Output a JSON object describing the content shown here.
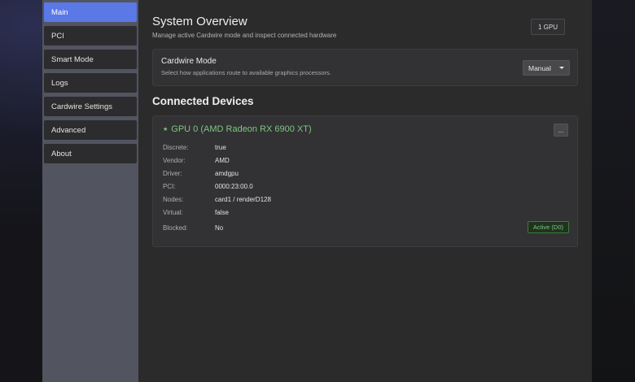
{
  "sidebar": {
    "items": [
      {
        "id": "main",
        "label": "Main",
        "active": true
      },
      {
        "id": "pci",
        "label": "PCI"
      },
      {
        "id": "smart-mode",
        "label": "Smart Mode"
      },
      {
        "id": "logs",
        "label": "Logs"
      },
      {
        "id": "cardwire-settings",
        "label": "Cardwire Settings"
      },
      {
        "id": "advanced",
        "label": "Advanced"
      },
      {
        "id": "about",
        "label": "About"
      }
    ]
  },
  "overview": {
    "title": "System Overview",
    "subtitle": "Manage active Cardwire mode and inspect connected hardware",
    "gpu_count_badge": "1 GPU"
  },
  "mode_card": {
    "title": "Cardwire Mode",
    "description": "Select how applications route to available graphics processors.",
    "selected_mode": "Manual"
  },
  "devices_section": {
    "title": "Connected Devices"
  },
  "device": {
    "star_glyph": "★",
    "name": "GPU 0 (AMD Radeon RX 6900 XT)",
    "more_label": "...",
    "properties": [
      {
        "label": "Discrete:",
        "value": "true"
      },
      {
        "label": "Vendor:",
        "value": "AMD"
      },
      {
        "label": "Driver:",
        "value": "amdgpu"
      },
      {
        "label": "PCI:",
        "value": "0000:23:00.0"
      },
      {
        "label": "Nodes:",
        "value": "card1 / renderD128"
      },
      {
        "label": "Virtual:",
        "value": "false"
      },
      {
        "label": "Blocked:",
        "value": "No"
      }
    ],
    "status_badge": "Active (D0)"
  },
  "colors": {
    "accent": "#5a79e6",
    "success": "#7fc67f",
    "sidebar_bg": "#525560",
    "panel_bg": "#2b2b2c"
  }
}
